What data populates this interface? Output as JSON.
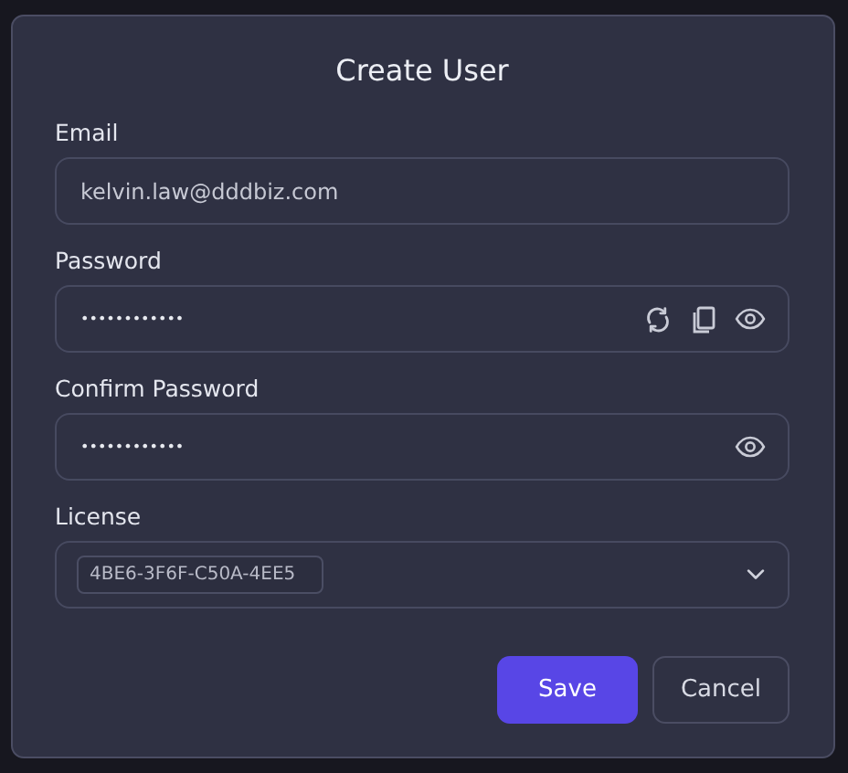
{
  "dialog": {
    "title": "Create User",
    "fields": [
      {
        "kind": "text",
        "label": "Email",
        "value": "kelvin.law@dddbiz.com"
      },
      {
        "kind": "password",
        "label": "Password",
        "value": "••••••••••••",
        "actions": [
          {
            "kind": "refresh"
          },
          {
            "kind": "copy"
          },
          {
            "kind": "reveal"
          }
        ]
      },
      {
        "kind": "password",
        "label": "Confirm Password",
        "value": "••••••••••••",
        "actions": [
          {
            "kind": "reveal"
          }
        ]
      },
      {
        "kind": "select",
        "label": "License",
        "chips": [
          "4BE6-3F6F-C50A-4EE5"
        ]
      }
    ],
    "buttons": [
      {
        "label": "Save",
        "kind": "primary"
      },
      {
        "label": "Cancel",
        "kind": "secondary"
      }
    ]
  }
}
